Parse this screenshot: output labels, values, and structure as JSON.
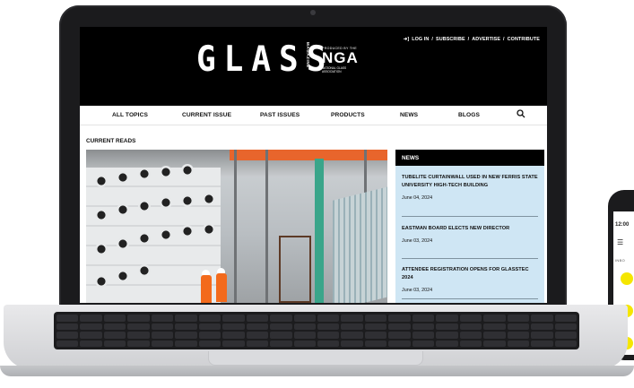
{
  "site": {
    "brand": "GLASS",
    "brand_sub": "MAGAZINE",
    "produced_by": "PRODUCED BY THE",
    "nga_logo": "NGA",
    "nga_tagline": "NATIONAL GLASS ASSOCIATION"
  },
  "top_links": {
    "login": "LOG IN",
    "sep1": "/",
    "subscribe": "SUBSCRIBE",
    "sep2": "/",
    "advertise": "ADVERTISE",
    "sep3": "/",
    "contribute": "CONTRIBUTE"
  },
  "nav": {
    "items": [
      "ALL TOPICS",
      "CURRENT ISSUE",
      "PAST ISSUES",
      "PRODUCTS",
      "NEWS",
      "BLOGS"
    ]
  },
  "main": {
    "section_title": "CURRENT READS"
  },
  "news": {
    "title": "NEWS",
    "items": [
      {
        "headline": "TUBELITE CURTAINWALL USED IN NEW FERRIS STATE UNIVERSITY HIGH-TECH BUILDING",
        "date": "June 04, 2024"
      },
      {
        "headline": "EASTMAN BOARD ELECTS NEW DIRECTOR",
        "date": "June 03, 2024"
      },
      {
        "headline": "ATTENDEE REGISTRATION OPENS FOR GLASSTEC 2024",
        "date": "June 03, 2024"
      }
    ]
  },
  "phone": {
    "time": "12:00",
    "inbox": "INBO"
  },
  "colors": {
    "header_bg": "#000000",
    "news_panel_bg": "#cfe6f4",
    "accent_yellow": "#f5e600"
  }
}
